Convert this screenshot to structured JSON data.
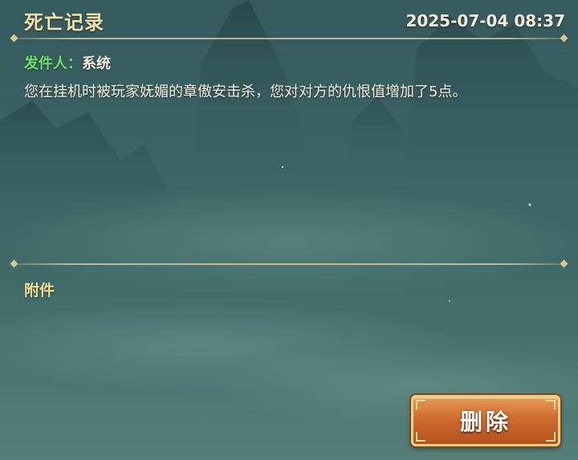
{
  "header": {
    "title": "死亡记录",
    "timestamp": "2025-07-04 08:37"
  },
  "mail": {
    "sender_label": "发件人：",
    "sender_name": "系统",
    "message": "您在挂机时被玩家妩媚的章傲安击杀，您对对方的仇恨值增加了5点。"
  },
  "attachments": {
    "label": "附件"
  },
  "actions": {
    "delete_label": "删除"
  },
  "colors": {
    "title": "#f3e3a6",
    "sender_label": "#6fe06a",
    "body_text": "#f5efdc",
    "attachment_label": "#f1de93",
    "button_fill": "#cf6c2f",
    "button_border": "#e9d08a"
  }
}
